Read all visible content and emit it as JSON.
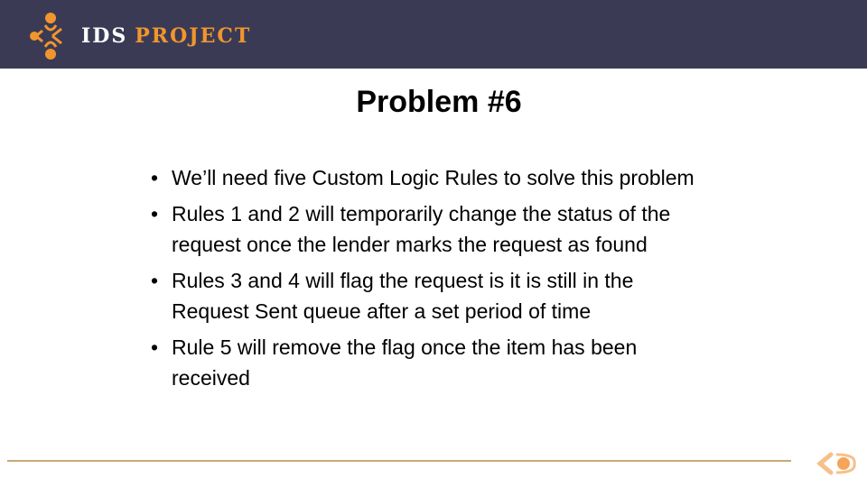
{
  "header": {
    "logo_text_1": "IDS",
    "logo_text_2": "PROJECT",
    "background_color": "#3b3a55",
    "accent_color": "#f0962d"
  },
  "slide": {
    "title": "Problem #6",
    "bullets": [
      {
        "text": "We’ll need five Custom Logic Rules to solve this problem"
      },
      {
        "text": "Rules 1 and 2 will temporarily change the status of the request once the lender marks the request as found"
      },
      {
        "text": "Rules 3 and 4 will flag the request is it is still in the Request Sent queue after a set period of time"
      },
      {
        "text": "Rule 5 will remove the flag once the item has been received"
      }
    ],
    "bullet_glyph": "•"
  },
  "footer": {
    "logo_icon": "ids-mark-icon"
  }
}
